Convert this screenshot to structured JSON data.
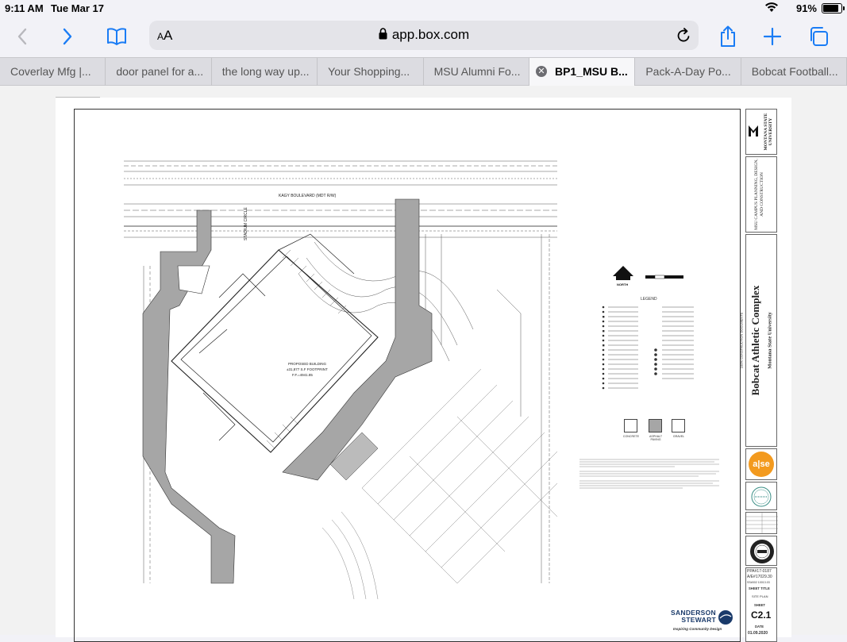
{
  "status": {
    "time": "9:11 AM",
    "date": "Tue Mar 17",
    "battery": "91%",
    "battery_level": 0.91
  },
  "toolbar": {
    "text_size_label": "AA",
    "url": "app.box.com"
  },
  "tabs": [
    {
      "label": "Coverlay Mfg |..."
    },
    {
      "label": "door panel for a..."
    },
    {
      "label": "the long way up..."
    },
    {
      "label": "Your Shopping..."
    },
    {
      "label": "MSU Alumni Fo..."
    },
    {
      "label": "BP1_MSU B...",
      "active": true
    },
    {
      "label": "Pack-A-Day Po..."
    },
    {
      "label": "Bobcat Football..."
    }
  ],
  "drawing": {
    "street_label": "KAGY BOULEVARD (MDT R/W)",
    "circle_label": "STADIUM CIRCLE",
    "building_label": "PROPOSED BUILDING",
    "building_footprint": "±31,877 S.F FOOTPRINT",
    "building_ff": "F.F.=4941.85",
    "north_label": "NORTH",
    "legend_title": "LEGEND",
    "swatches": [
      {
        "label": "CONCRETE",
        "color": "#ffffff"
      },
      {
        "label": "ASPHALT PAVING",
        "color": "#a6a6a6"
      },
      {
        "label": "GRAVEL",
        "color": "#ffffff"
      }
    ]
  },
  "title_block": {
    "university": "MONTANA STATE UNIVERSITY",
    "department": "MSU CAMPUS PLANNING, DESIGN, AND CONSTRUCTION",
    "phase": "100% CONSTRUCTION DOCUMENTS",
    "project": "Bobcat Athletic Complex",
    "project_sub": "Montana State University",
    "ase_logo": "a|se",
    "ppa": "PPA#17-0187",
    "ae": "A/E#17029.30",
    "job": "SS#002 10013.03",
    "sheet_title_label": "SHEET TITLE",
    "sheet_title": "SITE PLAN",
    "sheet_label": "SHEET",
    "sheet_number": "C2.1",
    "date_label": "DATE",
    "date": "01.09.2020",
    "firm": "SANDERSON STEWART",
    "firm_tagline": "Inspiring Community Design"
  },
  "colors": {
    "paving": "#a6a6a6",
    "ase_orange": "#f39a1e"
  }
}
